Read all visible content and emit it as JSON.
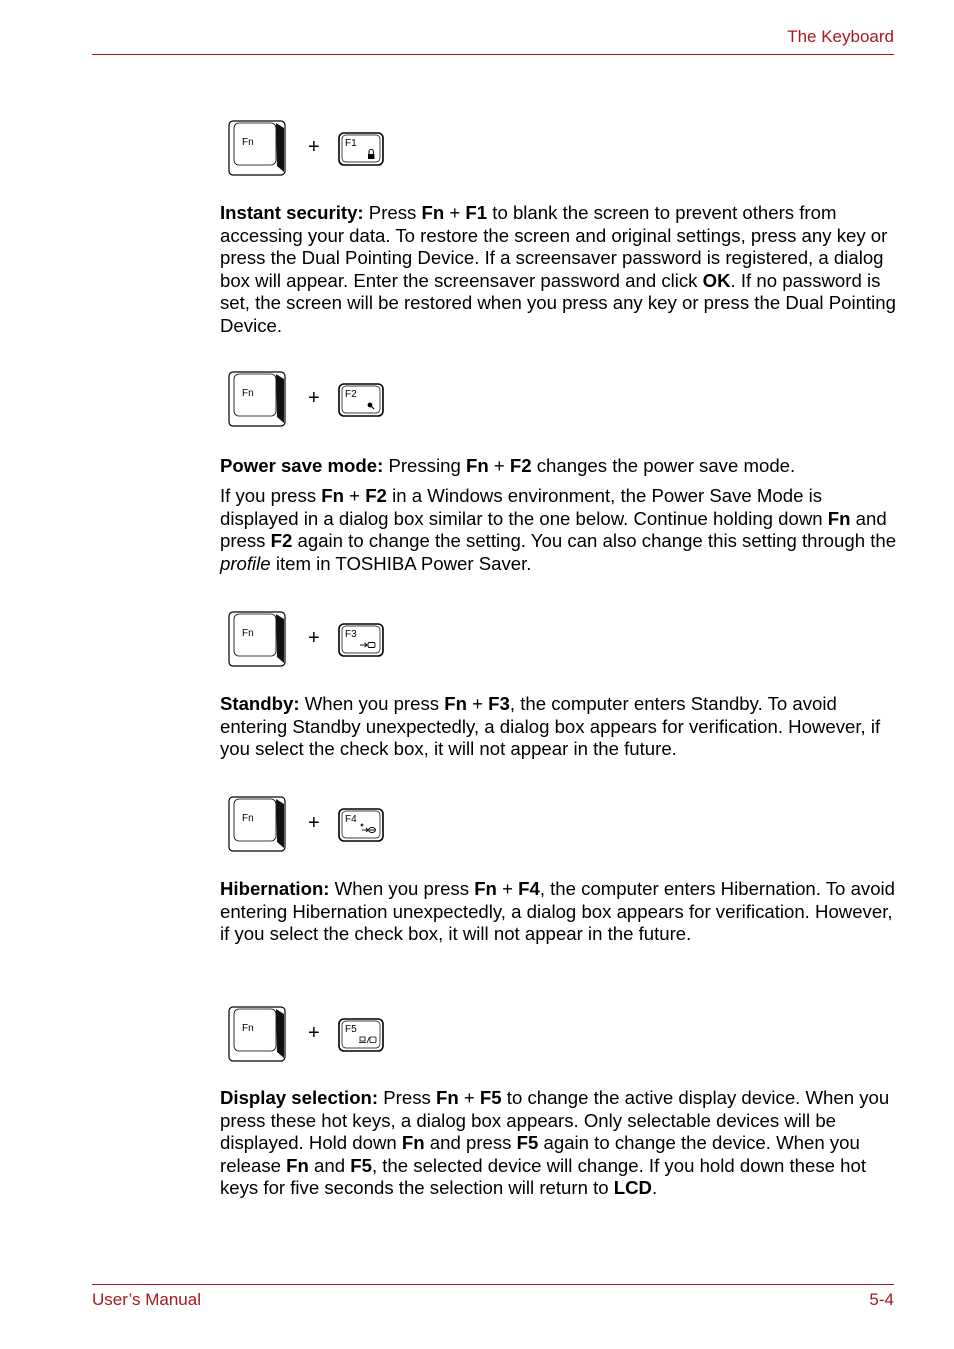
{
  "header": {
    "title": "The Keyboard"
  },
  "footer": {
    "left": "User’s Manual",
    "right": "5-4"
  },
  "hotkeys": [
    {
      "modifier": "Fn",
      "key": "F1",
      "plus": "+",
      "key_icon": "lock-icon",
      "paragraphs": [
        [
          {
            "t": "Instant security:",
            "b": true
          },
          {
            "t": " Press "
          },
          {
            "t": "Fn",
            "b": true
          },
          {
            "t": " + "
          },
          {
            "t": "F1",
            "b": true
          },
          {
            "t": " to blank the screen to prevent others from accessing your data. To restore the screen and original settings, press any key or press the Dual Pointing Device. If a screensaver password is registered, a dialog box will appear. Enter the screensaver password and click "
          },
          {
            "t": "OK",
            "b": true
          },
          {
            "t": ". If no password is set, the screen will be restored when you press any key or press the Dual Pointing Device."
          }
        ]
      ]
    },
    {
      "modifier": "Fn",
      "key": "F2",
      "plus": "+",
      "key_icon": "power-save-icon",
      "paragraphs": [
        [
          {
            "t": "Power save mode:",
            "b": true
          },
          {
            "t": " Pressing "
          },
          {
            "t": "Fn",
            "b": true
          },
          {
            "t": " + "
          },
          {
            "t": "F2",
            "b": true
          },
          {
            "t": " changes the power save mode."
          }
        ],
        [
          {
            "t": "If you press "
          },
          {
            "t": "Fn",
            "b": true
          },
          {
            "t": " + "
          },
          {
            "t": "F2",
            "b": true
          },
          {
            "t": " in a Windows environment, the Power Save Mode is displayed in a dialog box similar to the one below. Continue holding down "
          },
          {
            "t": "Fn",
            "b": true
          },
          {
            "t": " and press "
          },
          {
            "t": "F2",
            "b": true
          },
          {
            "t": " again to change the setting. You can also change this setting through the "
          },
          {
            "t": "profile",
            "i": true
          },
          {
            "t": " item in TOSHIBA Power Saver."
          }
        ]
      ]
    },
    {
      "modifier": "Fn",
      "key": "F3",
      "plus": "+",
      "key_icon": "standby-icon",
      "paragraphs": [
        [
          {
            "t": "Standby:",
            "b": true
          },
          {
            "t": " When you press "
          },
          {
            "t": "Fn",
            "b": true
          },
          {
            "t": " + "
          },
          {
            "t": "F3",
            "b": true
          },
          {
            "t": ", the computer enters Standby. To avoid entering Standby unexpectedly, a dialog box appears for verification. However, if you select the check box, it will not appear in the future."
          }
        ]
      ]
    },
    {
      "modifier": "Fn",
      "key": "F4",
      "plus": "+",
      "key_icon": "hibernation-icon",
      "paragraphs": [
        [
          {
            "t": "Hibernation:",
            "b": true
          },
          {
            "t": " When you press "
          },
          {
            "t": "Fn",
            "b": true
          },
          {
            "t": " + "
          },
          {
            "t": "F4",
            "b": true
          },
          {
            "t": ", the computer enters Hibernation. To avoid entering Hibernation unexpectedly, a dialog box appears for verification. However, if you select the check box, it will not appear in the future."
          }
        ]
      ]
    },
    {
      "modifier": "Fn",
      "key": "F5",
      "plus": "+",
      "key_icon": "display-switch-icon",
      "paragraphs": [
        [
          {
            "t": "Display selection:",
            "b": true
          },
          {
            "t": " Press "
          },
          {
            "t": "Fn",
            "b": true
          },
          {
            "t": " + "
          },
          {
            "t": "F5",
            "b": true
          },
          {
            "t": " to change the active display device. When you press these hot keys, a dialog box appears. Only selectable devices will be displayed. Hold down "
          },
          {
            "t": "Fn",
            "b": true
          },
          {
            "t": " and press "
          },
          {
            "t": "F5",
            "b": true
          },
          {
            "t": " again to change the device. When you release "
          },
          {
            "t": "Fn",
            "b": true
          },
          {
            "t": " and "
          },
          {
            "t": "F5",
            "b": true
          },
          {
            "t": ", the selected device will change. If you hold down these hot keys for five seconds the selection will return to "
          },
          {
            "t": "LCD",
            "b": true
          },
          {
            "t": "."
          }
        ]
      ]
    }
  ]
}
